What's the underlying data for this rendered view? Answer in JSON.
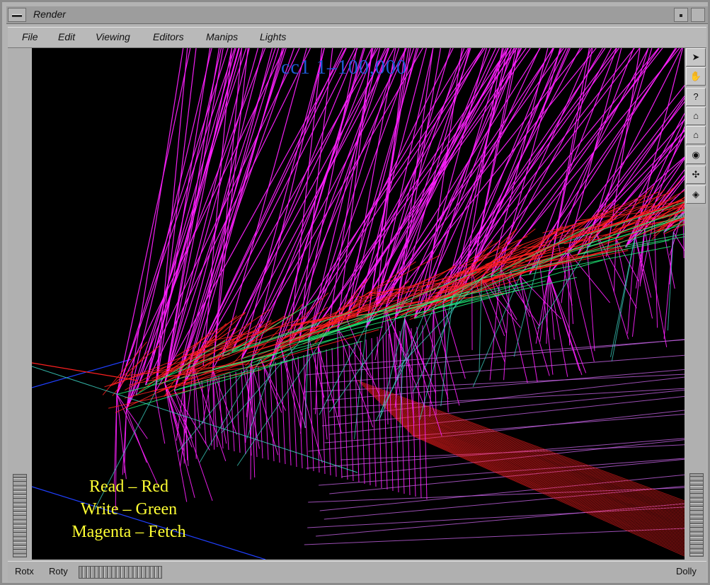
{
  "window": {
    "title": "Render"
  },
  "menu": [
    "File",
    "Edit",
    "Viewing",
    "Editors",
    "Manips",
    "Lights"
  ],
  "viewport": {
    "title": "cc1 1–100,000",
    "legend": [
      "Read – Red",
      "Write – Green",
      "Magenta – Fetch"
    ],
    "colors": {
      "read": "#ff2020",
      "write": "#20ff80",
      "fetch": "#ff20ff",
      "axis": "#2040ff",
      "legend": "#ffff33",
      "title": "#1e5bd6"
    }
  },
  "toolbar": [
    {
      "name": "pick-arrow-icon",
      "glyph": "➤"
    },
    {
      "name": "view-hand-icon",
      "glyph": "✋"
    },
    {
      "name": "help-icon",
      "glyph": "?"
    },
    {
      "name": "home-icon",
      "glyph": "⌂"
    },
    {
      "name": "set-home-icon",
      "glyph": "⌂"
    },
    {
      "name": "view-all-eye-icon",
      "glyph": "◉"
    },
    {
      "name": "seek-icon",
      "glyph": "✣"
    },
    {
      "name": "camera-type-icon",
      "glyph": "◈"
    }
  ],
  "bottom": {
    "rotx": "Rotx",
    "roty": "Roty",
    "dolly": "Dolly"
  }
}
